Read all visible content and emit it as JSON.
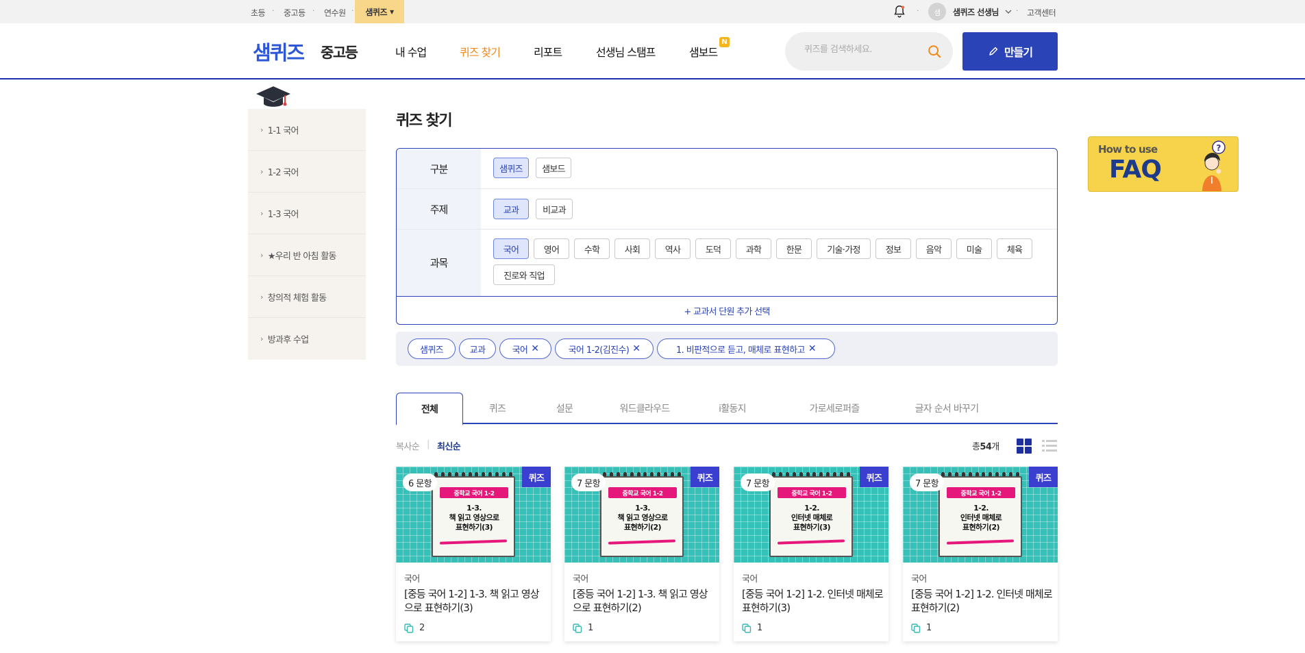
{
  "util": {
    "links": [
      "초등",
      "중고등",
      "연수원"
    ],
    "active": "샘퀴즈",
    "user_initial": "샘",
    "user_name": "샘퀴즈 선생님",
    "support": "고객센터"
  },
  "header": {
    "logo_main": "샘퀴즈",
    "logo_sub": "중고등",
    "nav": [
      "내 수업",
      "퀴즈 찾기",
      "리포트",
      "선생님 스탬프",
      "샘보드"
    ],
    "nav_badge": "N",
    "search_placeholder": "퀴즈를 검색하세요.",
    "make_label": "만들기"
  },
  "sidebar": {
    "items": [
      "1-1 국어",
      "1-2 국어",
      "1-3 국어",
      "★우리 반 아침 활동",
      "창의적 체험 활동",
      "방과후 수업"
    ]
  },
  "main": {
    "title": "퀴즈 찾기",
    "filter": {
      "row1_label": "구분",
      "row1_chips": [
        "샘퀴즈",
        "샘보드"
      ],
      "row2_label": "주제",
      "row2_chips": [
        "교과",
        "비교과"
      ],
      "row3_label": "과목",
      "row3_chips": [
        "국어",
        "영어",
        "수학",
        "사회",
        "역사",
        "도덕",
        "과학",
        "한문",
        "기술·가정",
        "정보",
        "음악",
        "미술",
        "체육",
        "진로와 직업"
      ],
      "add_unit": "+ 교과서 단원 추가 선택"
    },
    "applied": [
      "샘퀴즈",
      "교과",
      "국어",
      "국어 1-2(김진수)",
      "1. 비판적으로 듣고, 매체로 표현하고"
    ],
    "tabs": [
      "전체",
      "퀴즈",
      "설문",
      "워드클라우드",
      "i활동지",
      "가로세로퍼즐",
      "글자 순서 바꾸기"
    ],
    "sort": [
      "복사순",
      "최신순"
    ],
    "total_prefix": "총",
    "total_count": "54",
    "total_suffix": "개"
  },
  "cards": [
    {
      "count": "6 문항",
      "type": "퀴즈",
      "tag": "중학교 국어 1-2",
      "thumb_text": "1-3.\n책 읽고 영상으로\n표현하기(3)",
      "subject": "국어",
      "title": "[중등 국어 1-2] 1-3. 책 읽고 영상으로 표현하기(3)",
      "copies": "2"
    },
    {
      "count": "7 문항",
      "type": "퀴즈",
      "tag": "중학교 국어 1-2",
      "thumb_text": "1-3.\n책 읽고 영상으로\n표현하기(2)",
      "subject": "국어",
      "title": "[중등 국어 1-2] 1-3. 책 읽고 영상으로 표현하기(2)",
      "copies": "1"
    },
    {
      "count": "7 문항",
      "type": "퀴즈",
      "tag": "중학교 국어 1-2",
      "thumb_text": "1-2.\n인터넷 매체로\n표현하기(3)",
      "subject": "국어",
      "title": "[중등 국어 1-2] 1-2. 인터넷 매체로 표현하기(3)",
      "copies": "1"
    },
    {
      "count": "7 문항",
      "type": "퀴즈",
      "tag": "중학교 국어 1-2",
      "thumb_text": "1-2.\n인터넷 매체로\n표현하기(2)",
      "subject": "국어",
      "title": "[중등 국어 1-2] 1-2. 인터넷 매체로 표현하기(2)",
      "copies": "1"
    }
  ],
  "faq": {
    "how": "How to use",
    "title": "FAQ"
  },
  "colors": {
    "brand": "#2a43b6",
    "accent": "#f08a1a",
    "quiz_badge": "#3b3fcf",
    "thumb": "#35c0b8"
  }
}
